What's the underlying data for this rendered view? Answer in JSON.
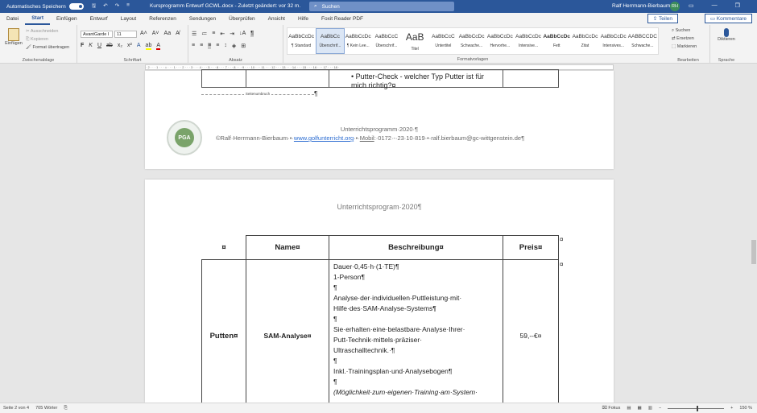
{
  "titlebar": {
    "autosave_label": "Automatisches Speichern",
    "autosave_state": "Ein",
    "document_title": "Kursprogramm Entwurf GCWL.docx  -  Zuletzt geändert: vor 32 m.",
    "search_placeholder": "Suchen",
    "user_name": "Ralf Herrmann-Bierbaum",
    "user_initials": "RH"
  },
  "menu": {
    "tabs": [
      "Datei",
      "Start",
      "Einfügen",
      "Entwurf",
      "Layout",
      "Referenzen",
      "Sendungen",
      "Überprüfen",
      "Ansicht",
      "Hilfe",
      "Foxit Reader PDF"
    ],
    "active_tab": "Start",
    "share_label": "Teilen",
    "comments_label": "Kommentare"
  },
  "ribbon": {
    "clipboard": {
      "paste_label": "Einfügen",
      "cut_label": "Ausschneiden",
      "copy_label": "Kopieren",
      "format_painter_label": "Format übertragen",
      "group_label": "Zwischenablage"
    },
    "font": {
      "font_name": "AvantGarde I",
      "font_size": "11",
      "group_label": "Schriftart"
    },
    "paragraph": {
      "group_label": "Absatz"
    },
    "styles": {
      "group_label": "Formatvorlagen",
      "items": [
        {
          "sample": "AaBbCcDc",
          "name": "¶ Standard"
        },
        {
          "sample": "AaBbCc",
          "name": "Überschrif..."
        },
        {
          "sample": "AaBbCcDc",
          "name": "¶ Kein Lee..."
        },
        {
          "sample": "AaBbCcC",
          "name": "Überschrif..."
        },
        {
          "sample": "AaB",
          "name": "Titel"
        },
        {
          "sample": "AaBbCcC",
          "name": "Untertitel"
        },
        {
          "sample": "AaBbCcDc",
          "name": "Schwache..."
        },
        {
          "sample": "AaBbCcDc",
          "name": "Hervorhe..."
        },
        {
          "sample": "AaBbCcDc",
          "name": "Intensive..."
        },
        {
          "sample": "AaBbCcDc",
          "name": "Fett"
        },
        {
          "sample": "AaBbCcDc",
          "name": "Zitat"
        },
        {
          "sample": "AaBbCcDc",
          "name": "Intensives..."
        },
        {
          "sample": "AABBCCDC",
          "name": "Schwache..."
        }
      ],
      "selected_index": 1
    },
    "editing": {
      "find_label": "Suchen",
      "replace_label": "Ersetzen",
      "select_label": "Markieren",
      "group_label": "Bearbeiten"
    },
    "voice": {
      "dictate_label": "Diktieren",
      "group_label": "Sprache"
    }
  },
  "ruler_text": "· 2 · · · 1 · · · ⌂ · · · 1 · · · 2 · · · 3 · · · 4 · · · 5 · · · 6 · · · 7 · · · 8 · · · 9 · · · 10 · · · 11 · · · 12 · · · 13 · · · 14 · · · 15 · · · 16 · · · 17 · · · 18 ·",
  "page1": {
    "table_tail_line1": "• Putter-Check - welcher Typ Putter ist für",
    "table_tail_line2": "mich richtig?¤",
    "page_break_label": "Seitenumbruch",
    "pilcrow": "¶",
    "logo_text": "PGA",
    "footer_line1": "Unterrichtsprogramm·2020·¶",
    "footer_line2_prefix": "©Ralf·Herrmann-Bierbaum·•·",
    "footer_link": "www.golfunterricht.org",
    "footer_line2_mid": "·•·",
    "footer_mobile_label": "Mobil",
    "footer_line2_suffix": ":·0172·-·23·10·819·•·ralf.bierbaum@gc-wittgenstein.de¶"
  },
  "page2": {
    "header": "Unterrichtsprogram·2020¶",
    "table": {
      "headers": [
        "¤",
        "Name¤",
        "Beschreibung¤",
        "Preis¤"
      ],
      "end_mark": "¤",
      "row": {
        "category": "Putten¤",
        "name": "SAM-Analyse¤",
        "price": "59,--€¤",
        "description": [
          "Dauer·0,45·h·(1·TE)¶",
          "1-Person¶",
          "¶",
          "Analyse·der·individuellen·Puttleistung·mit·",
          "Hilfe·des·SAM-Analyse-Systems¶",
          "¶",
          "Sie·erhalten·eine·belastbare·Analyse·Ihrer·",
          "Putt-Technik·mittels·präziser·",
          "Ultraschalltechnik.·¶",
          "¶",
          "Inkl.·Trainingsplan·und·Analysebogen¶",
          "¶",
          "(Möglichkeit·zum·eigenen·Training·am·System·"
        ]
      }
    }
  },
  "statusbar": {
    "page": "Seite 2 von 4",
    "words": "705 Wörter",
    "focus": "Fokus",
    "zoom": "150 %"
  }
}
